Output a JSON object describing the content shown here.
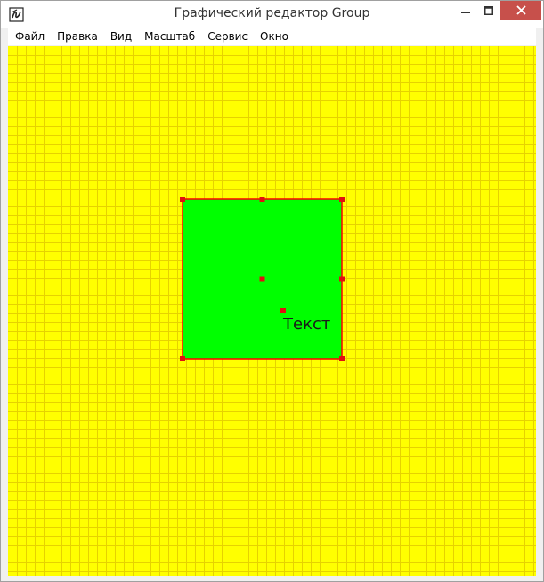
{
  "window": {
    "title": "Графический редактор Group"
  },
  "menu": {
    "items": [
      {
        "id": "file",
        "label": "Файл"
      },
      {
        "id": "edit",
        "label": "Правка"
      },
      {
        "id": "view",
        "label": "Вид"
      },
      {
        "id": "zoom",
        "label": "Масштаб"
      },
      {
        "id": "service",
        "label": "Сервис"
      },
      {
        "id": "window",
        "label": "Окно"
      }
    ]
  },
  "canvas": {
    "background_color": "#ffff00",
    "grid_color": "#e6d200",
    "shape": {
      "type": "rectangle",
      "fill_color": "#00ff00",
      "border_color": "#ff0000",
      "selected": true,
      "handle_color": "#e01010"
    },
    "text_object": {
      "text": "Текст",
      "color": "#1a1a1a"
    }
  },
  "icons": {
    "app": "app-logo-icon",
    "minimize": "minimize-icon",
    "maximize": "maximize-icon",
    "close": "close-icon"
  }
}
